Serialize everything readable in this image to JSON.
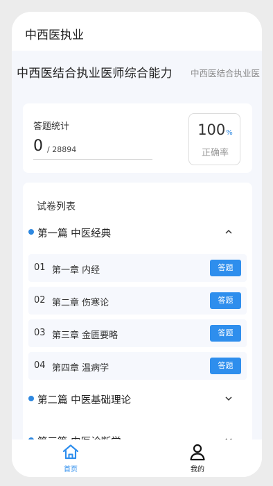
{
  "app": {
    "title": "中西医执业"
  },
  "tabs": {
    "active": "中西医结合执业医师综合能力",
    "next": "中西医结合执业医"
  },
  "stats": {
    "label": "答题统计",
    "answered": "0",
    "total": "/ 28894",
    "accuracy_value": "100",
    "accuracy_unit": "%",
    "accuracy_label": "正确率"
  },
  "paper_list": {
    "heading": "试卷列表",
    "sections": [
      {
        "title": "第一篇 中医经典",
        "expanded": true,
        "chapters": [
          {
            "num": "01",
            "name": "第一章 内经",
            "action": "答题"
          },
          {
            "num": "02",
            "name": "第二章 伤寒论",
            "action": "答题"
          },
          {
            "num": "03",
            "name": "第三章 金匮要略",
            "action": "答题"
          },
          {
            "num": "04",
            "name": "第四章 温病学",
            "action": "答题"
          }
        ]
      },
      {
        "title": "第二篇 中医基础理论",
        "expanded": false
      },
      {
        "title": "第三篇 中医诊断学",
        "expanded": false
      }
    ]
  },
  "bottom_nav": [
    {
      "label": "首页",
      "icon": "home-icon",
      "active": true
    },
    {
      "label": "我的",
      "icon": "person-icon",
      "active": false
    }
  ],
  "colors": {
    "accent": "#2e8eed",
    "dot": "#2e88e0",
    "page_bg": "#f5f7fc"
  }
}
